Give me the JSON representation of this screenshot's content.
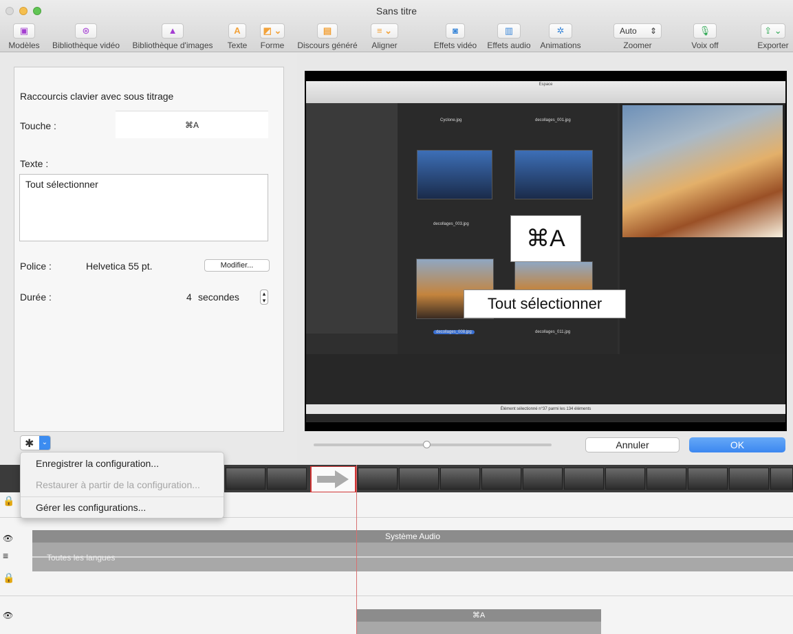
{
  "window": {
    "title": "Sans titre"
  },
  "toolbar": {
    "items": [
      {
        "label": "Modèles",
        "icon": "templates-icon"
      },
      {
        "label": "Bibliothèque vidéo",
        "icon": "video-library-icon"
      },
      {
        "label": "Bibliothèque d'images",
        "icon": "image-library-icon"
      },
      {
        "label": "Texte",
        "icon": "text-icon",
        "glyph": "A"
      },
      {
        "label": "Forme",
        "icon": "shape-icon"
      },
      {
        "label": "Discours généré",
        "icon": "speech-icon"
      },
      {
        "label": "Aligner",
        "icon": "align-icon"
      },
      {
        "label": "Effets vidéo",
        "icon": "video-effects-icon"
      },
      {
        "label": "Effets audio",
        "icon": "audio-effects-icon"
      },
      {
        "label": "Animations",
        "icon": "animations-icon"
      },
      {
        "label": "Zoomer",
        "icon": "zoom-select",
        "value": "Auto"
      },
      {
        "label": "Voix off",
        "icon": "microphone-icon"
      },
      {
        "label": "Exporter",
        "icon": "share-icon"
      }
    ]
  },
  "panel": {
    "title": "Raccourcis clavier avec sous titrage",
    "key_label": "Touche :",
    "key_value": "⌘A",
    "text_label": "Texte :",
    "text_value": "Tout sélectionner",
    "font_label": "Police :",
    "font_value": "Helvetica 55 pt.",
    "modify_button": "Modifier...",
    "duration_label": "Durée :",
    "duration_value": "4",
    "duration_unit": "secondes"
  },
  "preview": {
    "overlay_key": "⌘A",
    "overlay_text": "Tout sélectionner",
    "screen_title": "Espace",
    "captions": [
      "Cyclone.jpg",
      "decollages_001.jpg",
      "decollages_003.jpg",
      "decollages_008.jpg",
      "decollages_011.jpg"
    ],
    "status": "Élément sélectionné n°37 parmi les 134 éléments"
  },
  "dialog": {
    "cancel": "Annuler",
    "ok": "OK"
  },
  "menu": {
    "items": [
      {
        "label": "Enregistrer la configuration...",
        "enabled": true
      },
      {
        "label": "Restaurer à partir de la configuration...",
        "enabled": false
      },
      {
        "label": "Gérer les configurations...",
        "enabled": true
      }
    ]
  },
  "timeline": {
    "audio_track_title": "Système Audio",
    "audio_language": "Toutes les langues",
    "subtitle_clip": "⌘A"
  },
  "colors": {
    "accent": "#3c8cf0",
    "playhead": "#d87070"
  }
}
